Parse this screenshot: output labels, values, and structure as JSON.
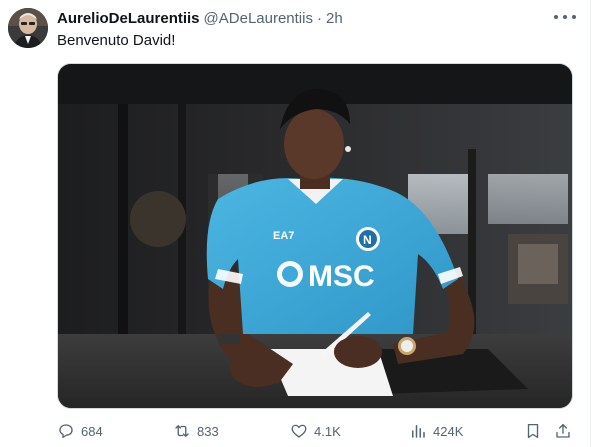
{
  "tweet": {
    "display_name": "AurelioDeLaurentiis",
    "handle": "@ADeLaurentiis",
    "separator": "·",
    "time": "2h",
    "text": "Benvenuto David!",
    "image": {
      "jersey_sponsor": "MSC",
      "kit_brand": "EA7",
      "club_crest": "N"
    }
  },
  "actions": {
    "replies": "684",
    "reposts": "833",
    "likes": "4.1K",
    "views": "424K"
  },
  "colors": {
    "text_primary": "#0f1419",
    "text_secondary": "#536471",
    "border": "#cfd9de",
    "jersey": "#3fa9d8"
  },
  "icons": [
    "more-icon",
    "reply-icon",
    "repost-icon",
    "like-icon",
    "views-icon",
    "bookmark-icon",
    "share-icon"
  ]
}
